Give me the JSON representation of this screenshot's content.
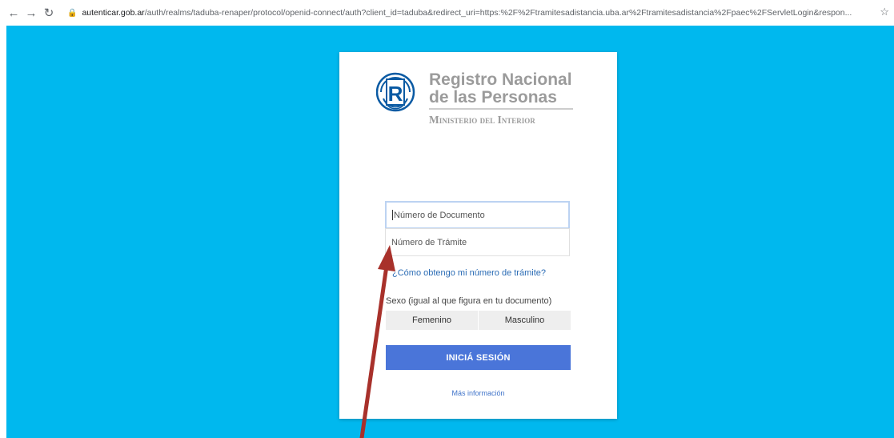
{
  "browser": {
    "back_icon": "back-arrow-icon",
    "forward_icon": "forward-arrow-icon",
    "reload_icon": "reload-icon",
    "url_host": "autenticar.gob.ar",
    "url_path": "/auth/realms/taduba-renaper/protocol/openid-connect/auth?client_id=taduba&redirect_uri=https:%2F%2Ftramitesadistancia.uba.ar%2Ftramitesadistancia%2Fpaec%2FServletLogin&respon..."
  },
  "logo": {
    "line1": "Registro Nacional",
    "line2": "de las Personas",
    "line3": "Ministerio del Interior",
    "letter": "R"
  },
  "form": {
    "documento_placeholder": "Número de Documento",
    "tramite_placeholder": "Número de Trámite",
    "help_link": "¿Cómo obtengo mi número de trámite?",
    "sexo_label": "Sexo (igual al que figura en tu documento)",
    "sexo_options": [
      "Femenino",
      "Masculino"
    ],
    "login_button": "INICIÁ SESIÓN",
    "more_info": "Más información"
  },
  "colors": {
    "page_background": "#00b8ee",
    "button": "#4a75d9",
    "annotation_arrow": "#a8312b"
  }
}
